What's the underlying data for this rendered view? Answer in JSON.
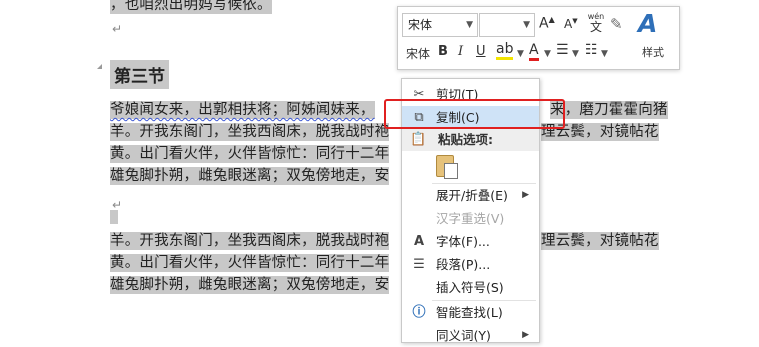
{
  "document": {
    "top_line": "，也咱烈出明妈写候依。",
    "heading": "第三节",
    "para1": [
      [
        "爷娘闻女来，出郭相扶将；阿姊闻妹来，",
        "来，磨刀霍霍向猪"
      ],
      [
        "羊。开我东阁门，坐我西阁床，脱我战时袍",
        "理云鬓，对镜帖花"
      ],
      [
        "黄。出门看火伴，火伴皆惊忙：同行十二年",
        ""
      ],
      [
        "雄兔脚扑朔，雌兔眼迷离；双兔傍地走，安",
        ""
      ]
    ],
    "para2": [
      [
        "羊。开我东阁门，坐我西阁床，脱我战时袍",
        "理云鬓，对镜帖花"
      ],
      [
        "黄。出门看火伴，火伴皆惊忙：同行十二年",
        ""
      ],
      [
        "雄兔脚扑朔，雌兔眼迷离；双兔傍地走，安",
        ""
      ]
    ]
  },
  "mini_toolbar": {
    "font_name": "宋体",
    "font_size": "",
    "grow_font": "A",
    "shrink_font": "A",
    "phonetic_top": "wén",
    "phonetic_bottom": "文",
    "font_label": "宋体",
    "bold": "B",
    "italic": "I",
    "underline": "U",
    "font_color_letter": "A",
    "styles_icon_letter": "A",
    "styles_label": "样式"
  },
  "context_menu": {
    "cut": "剪切(T)",
    "copy": "复制(C)",
    "paste_header": "粘贴选项:",
    "expand_collapse": "展开/折叠(E)",
    "reconvert": "汉字重选(V)",
    "font": "字体(F)...",
    "paragraph": "段落(P)...",
    "insert_symbol": "插入符号(S)",
    "smart_lookup": "智能查找(L)",
    "synonyms": "同义词(Y)"
  },
  "colors": {
    "highlight": "#cfe3f7",
    "annotation_box": "#e02020",
    "selection": "#c8c8c8"
  }
}
